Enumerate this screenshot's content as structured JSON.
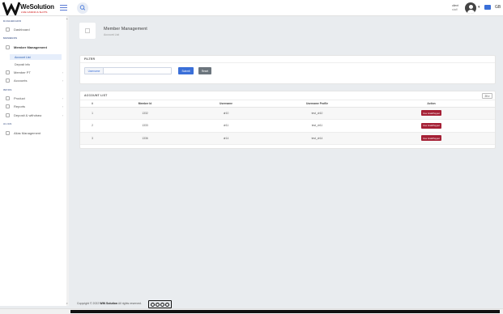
{
  "topbar": {
    "brand": "WeSolution",
    "brand_sub": "LIVE CASINO & SLOTS",
    "user_name": "client",
    "user_role": "staff",
    "lang": "GB"
  },
  "sidebar": {
    "sections": {
      "dashboard": "DASHBOARD",
      "members": "MEMBERS",
      "infos": "INFOS",
      "alias": "ALIAS"
    },
    "items": {
      "dashboard": "Dashboard",
      "member_management": "Member Management",
      "account_list": "Account List",
      "deposit_info": "Deposit info",
      "member_pt": "Member PT",
      "accounts": "Accounts",
      "product": "Product",
      "reports": "Reports",
      "deposit_withdraw": "Deposit & withdraw",
      "alias_management": "Alias Management"
    }
  },
  "page": {
    "title": "Member Management",
    "subtitle": "Account List"
  },
  "filter": {
    "heading": "FILTER",
    "label": "Username",
    "value": "",
    "submit": "Submit",
    "reset": "Reset"
  },
  "account_list": {
    "heading": "ACCOUNT LIST",
    "page_size": "25",
    "columns": [
      "#",
      "Member Id",
      "Username",
      "Username Profile",
      "Action"
    ],
    "rows": [
      {
        "idx": "1",
        "member_id": "1332",
        "username": "dr10",
        "profile": "test_dr10",
        "action": "Use GrabPaypet"
      },
      {
        "idx": "2",
        "member_id": "1333",
        "username": "dr11",
        "profile": "test_dr11",
        "action": "Use GrabPaypet"
      },
      {
        "idx": "3",
        "member_id": "1336",
        "username": "dr14",
        "profile": "test_dr14",
        "action": "Use GrabPaypet"
      }
    ]
  },
  "footer": {
    "prefix": "Copyright © 2022",
    "brand": "WIN Solution",
    "suffix": "All rights reserved."
  },
  "colors": {
    "accent": "#3a6fd8",
    "action": "#a52035",
    "reset": "#6c757d"
  }
}
